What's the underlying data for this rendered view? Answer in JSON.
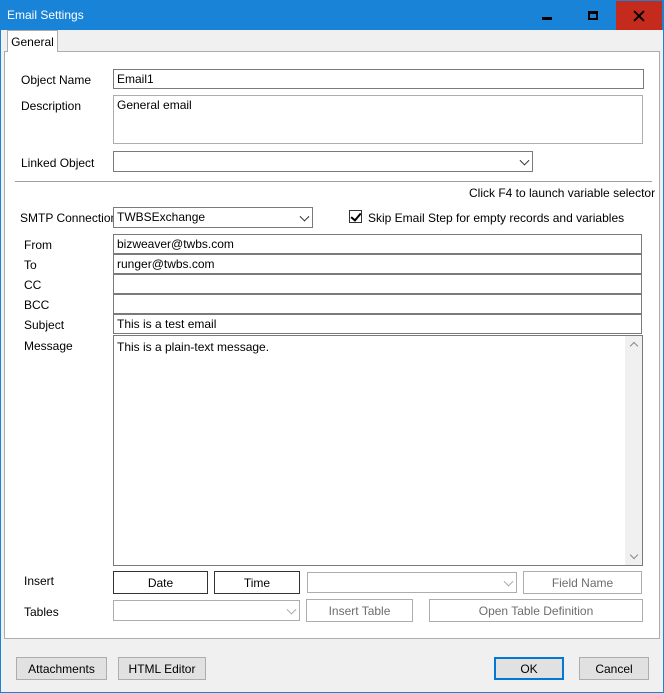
{
  "window": {
    "title": "Email Settings"
  },
  "tabs": [
    {
      "label": "General"
    }
  ],
  "object": {
    "name_label": "Object Name",
    "name_value": "Email1",
    "description_label": "Description",
    "description_value": "General email",
    "linked_label": "Linked Object",
    "linked_value": ""
  },
  "hint": "Click F4 to launch variable selector",
  "smtp": {
    "label": "SMTP Connection",
    "value": "TWBSExchange",
    "skip_label": "Skip Email Step for empty records and variables",
    "skip_checked": true
  },
  "fields": {
    "from_label": "From",
    "from_value": "bizweaver@twbs.com",
    "to_label": "To",
    "to_value": "runger@twbs.com",
    "cc_label": "CC",
    "cc_value": "",
    "bcc_label": "BCC",
    "bcc_value": "",
    "subject_label": "Subject",
    "subject_value": "This is a test email",
    "message_label": "Message",
    "message_value": "This is a plain-text message."
  },
  "insert": {
    "label": "Insert",
    "date_button": "Date",
    "time_button": "Time",
    "field_value": "",
    "field_name_button": "Field Name"
  },
  "tables": {
    "label": "Tables",
    "value": "",
    "insert_table_button": "Insert Table",
    "open_definition_button": "Open Table Definition"
  },
  "footer": {
    "attachments_button": "Attachments",
    "html_editor_button": "HTML Editor",
    "ok_button": "OK",
    "cancel_button": "Cancel"
  },
  "colors": {
    "titlebar": "#1883d7",
    "close_hover": "#c42b1c",
    "default_button_border": "#0078d7"
  }
}
